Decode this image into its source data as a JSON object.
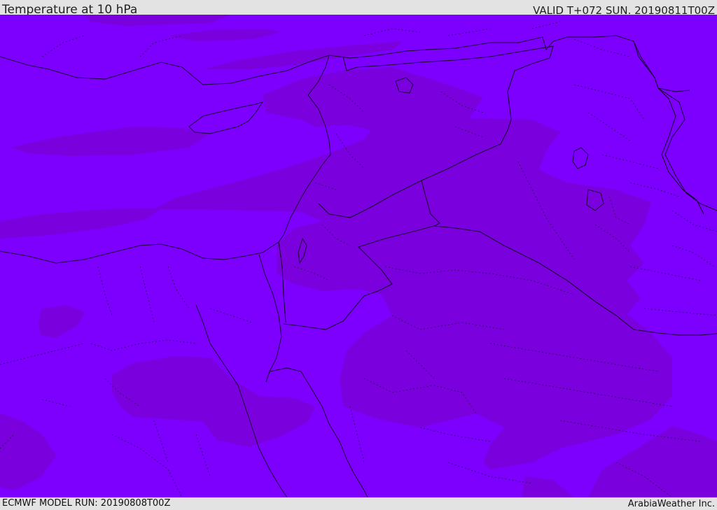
{
  "header": {
    "title": "Temperature at 10 hPa",
    "valid_time": "VALID T+072 SUN. 20190811T00Z"
  },
  "footer": {
    "model_run": "ECMWF MODEL RUN: 20190808T00Z",
    "credit": "ArabiaWeather Inc."
  },
  "colors": {
    "field_warm": "#7d00ff",
    "field_cool": "#7a00dd",
    "bar_background": "#e3e3e3",
    "lines": "#1a0033"
  }
}
